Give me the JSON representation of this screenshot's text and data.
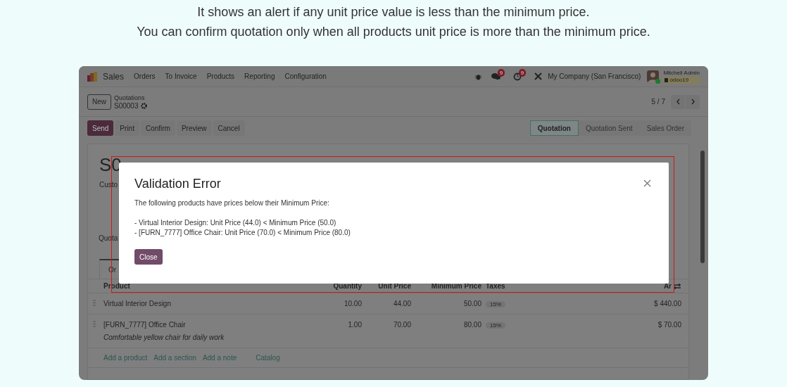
{
  "caption": [
    "It shows an alert if any unit price value is less than the minimum price.",
    "You can confirm quotation only when all products unit price is more than the minimum price."
  ],
  "navbar": {
    "app": "Sales",
    "menu": [
      "Orders",
      "To Invoice",
      "Products",
      "Reporting",
      "Configuration"
    ],
    "messages_badge": "9",
    "activities_badge": "9",
    "company": "My Company (San Francisco)",
    "user": "Mitchell Admin",
    "database": "odoo19"
  },
  "control_panel": {
    "new_button": "New",
    "breadcrumb": "Quotations",
    "record": "S00003",
    "pager": "5 / 7"
  },
  "actions": [
    {
      "label": "Send",
      "kind": "primary"
    },
    {
      "label": "Print",
      "kind": "secondary"
    },
    {
      "label": "Confirm",
      "kind": "secondary"
    },
    {
      "label": "Preview",
      "kind": "secondary"
    },
    {
      "label": "Cancel",
      "kind": "secondary"
    }
  ],
  "status_steps": [
    {
      "label": "Quotation",
      "selected": true
    },
    {
      "label": "Quotation Sent",
      "selected": false
    },
    {
      "label": "Sales Order",
      "selected": false
    }
  ],
  "sheet": {
    "title": "S0",
    "customer_label": "Custo",
    "section_label": "Quota",
    "tabs": [
      {
        "label": "Or",
        "selected": true
      }
    ]
  },
  "table": {
    "columns": [
      "Product",
      "Quantity",
      "Unit Price",
      "Minimum Price",
      "Taxes",
      "Ar"
    ],
    "rows": [
      {
        "product": "Virtual Interior Design",
        "description": "",
        "quantity": "10.00",
        "unit_price": "44.00",
        "minimum_price": "50.00",
        "tax": "15%",
        "amount": "$ 440.00"
      },
      {
        "product": "[FURN_7777] Office Chair",
        "description": "Comfortable yellow chair for daily work",
        "quantity": "1.00",
        "unit_price": "70.00",
        "minimum_price": "80.00",
        "tax": "15%",
        "amount": "$ 70.00"
      }
    ],
    "add_links": [
      "Add a product",
      "Add a section",
      "Add a note",
      "Catalog"
    ]
  },
  "dialog": {
    "title": "Validation Error",
    "message": "The following products have prices below their Minimum Price:",
    "lines": [
      "- Virtual Interior Design: Unit Price (44.0) < Minimum Price (50.0)",
      "- [FURN_7777] Office Chair: Unit Price (70.0) < Minimum Price (80.0)"
    ],
    "close_button": "Close"
  }
}
